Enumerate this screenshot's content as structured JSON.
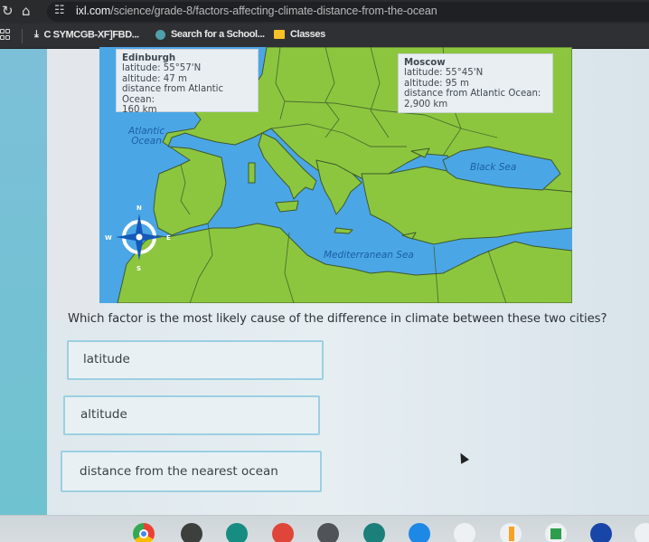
{
  "browser": {
    "url_domain": "ixl.com",
    "url_path": "/science/grade-8/factors-affecting-climate-distance-from-the-ocean",
    "icons": [
      "reload-icon",
      "home-icon",
      "site-settings-icon"
    ],
    "bookmarks": [
      {
        "label": "C SYMCGB-XF]FBD...",
        "icon": "download-icon"
      },
      {
        "label": "Search for a School...",
        "icon": "school-search-icon"
      },
      {
        "label": "Classes",
        "icon": "google-classroom-icon"
      }
    ]
  },
  "map": {
    "edinburgh": {
      "name": "Edinburgh",
      "latitude": "latitude: 55°57'N",
      "altitude": "altitude: 47 m",
      "distance_label": "distance from Atlantic Ocean:",
      "distance": "160 km"
    },
    "moscow": {
      "name": "Moscow",
      "latitude": "latitude: 55°45'N",
      "altitude": "altitude: 95 m",
      "distance_label": "distance from Atlantic Ocean:",
      "distance": "2,900 km"
    },
    "labels": {
      "atlantic_line1": "Atlantic",
      "atlantic_line2": "Ocean",
      "black_sea": "Black Sea",
      "mediterranean": "Mediterranean Sea"
    },
    "compass": {
      "n": "N",
      "s": "S",
      "e": "E",
      "w": "W"
    },
    "colors": {
      "water": "#4ba6e6",
      "land": "#8cc63f",
      "border": "#3d5a2a",
      "label": "#1a5fa6"
    }
  },
  "question": {
    "text": "Which factor is the most likely cause of the difference in climate between these two cities?",
    "options": [
      "latitude",
      "altitude",
      "distance from the nearest ocean"
    ]
  },
  "shelf": {
    "apps": [
      "chrome-icon",
      "vocab-app-icon",
      "classroom-slides-icon",
      "canvas-paint-icon",
      "clock-app-icon",
      "starburst-app-icon",
      "zoom-video-icon",
      "kids-app-icon",
      "slides-app-icon",
      "google-classroom-icon",
      "kahoot-icon",
      "docs-app-icon"
    ]
  }
}
